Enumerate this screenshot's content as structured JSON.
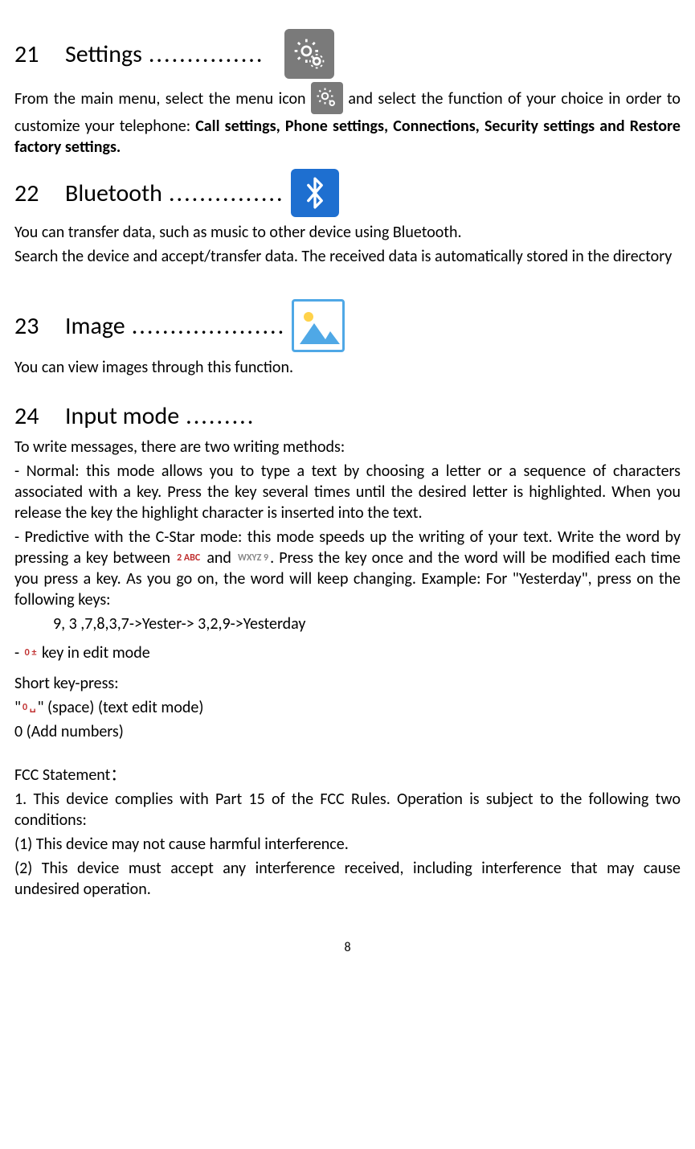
{
  "sections": {
    "settings": {
      "num": "21",
      "title": "Settings",
      "dots": "...............",
      "body_before": "From the main menu, select the menu icon",
      "body_after": "and select the function of your choice in order to customize your telephone: ",
      "bold_list": "Call settings, Phone settings, Connections, Security settings and Restore factory settings."
    },
    "bluetooth": {
      "num": "22",
      "title": "Bluetooth",
      "dots": "...............",
      "line1": "You can transfer data, such as music to other device using Bluetooth.",
      "line2": "Search the device and accept/transfer data. The received data is automatically stored in the directory"
    },
    "image": {
      "num": "23",
      "title": "Image",
      "dots": "....................",
      "body": "You can view images through this function."
    },
    "input": {
      "num": "24",
      "title": "Input mode",
      "dots": ".........",
      "intro": "To write messages, there are two writing methods:",
      "normal": "- Normal: this mode allows you to type a text by choosing a letter or a sequence of characters associated with a key. Press the key several times until the desired letter is highlighted. When you release the key the highlight character is inserted into the text.",
      "predictive_before": "- Predictive with the C-Star mode: this mode speeds up the writing of your text. Write the word by pressing a key between",
      "predictive_mid": "and",
      "predictive_after": ". Press the key once and the word will be modified each time you press a key. As you go on, the word will keep changing. Example: For \"Yesterday\", press on the following keys:",
      "sequence": "9, 3 ,7,8,3,7->Yester-> 3,2,9->Yesterday",
      "key0_line_prefix": "-  ",
      "key0_line_suffix": "  key in edit mode",
      "short_heading": "Short key-press:",
      "short_space_before": "\"",
      "short_space_after": "\" (space) (text edit mode)",
      "short_zero": "0 (Add numbers)"
    },
    "fcc": {
      "heading": "FCC Statement：",
      "line1": "1. This device complies with Part 15 of the   FCC Rules. Operation is subject to the following two conditions:",
      "line2": "(1) This device may not cause harmful interference.",
      "line3": "(2) This device must accept any interference received, including interference that may cause undesired operation."
    }
  },
  "key_labels": {
    "two": "2 ABC",
    "nine": "WXYZ 9",
    "zero_plus": "0 ±",
    "zero_space": "0 ␣"
  },
  "page_number": "8"
}
